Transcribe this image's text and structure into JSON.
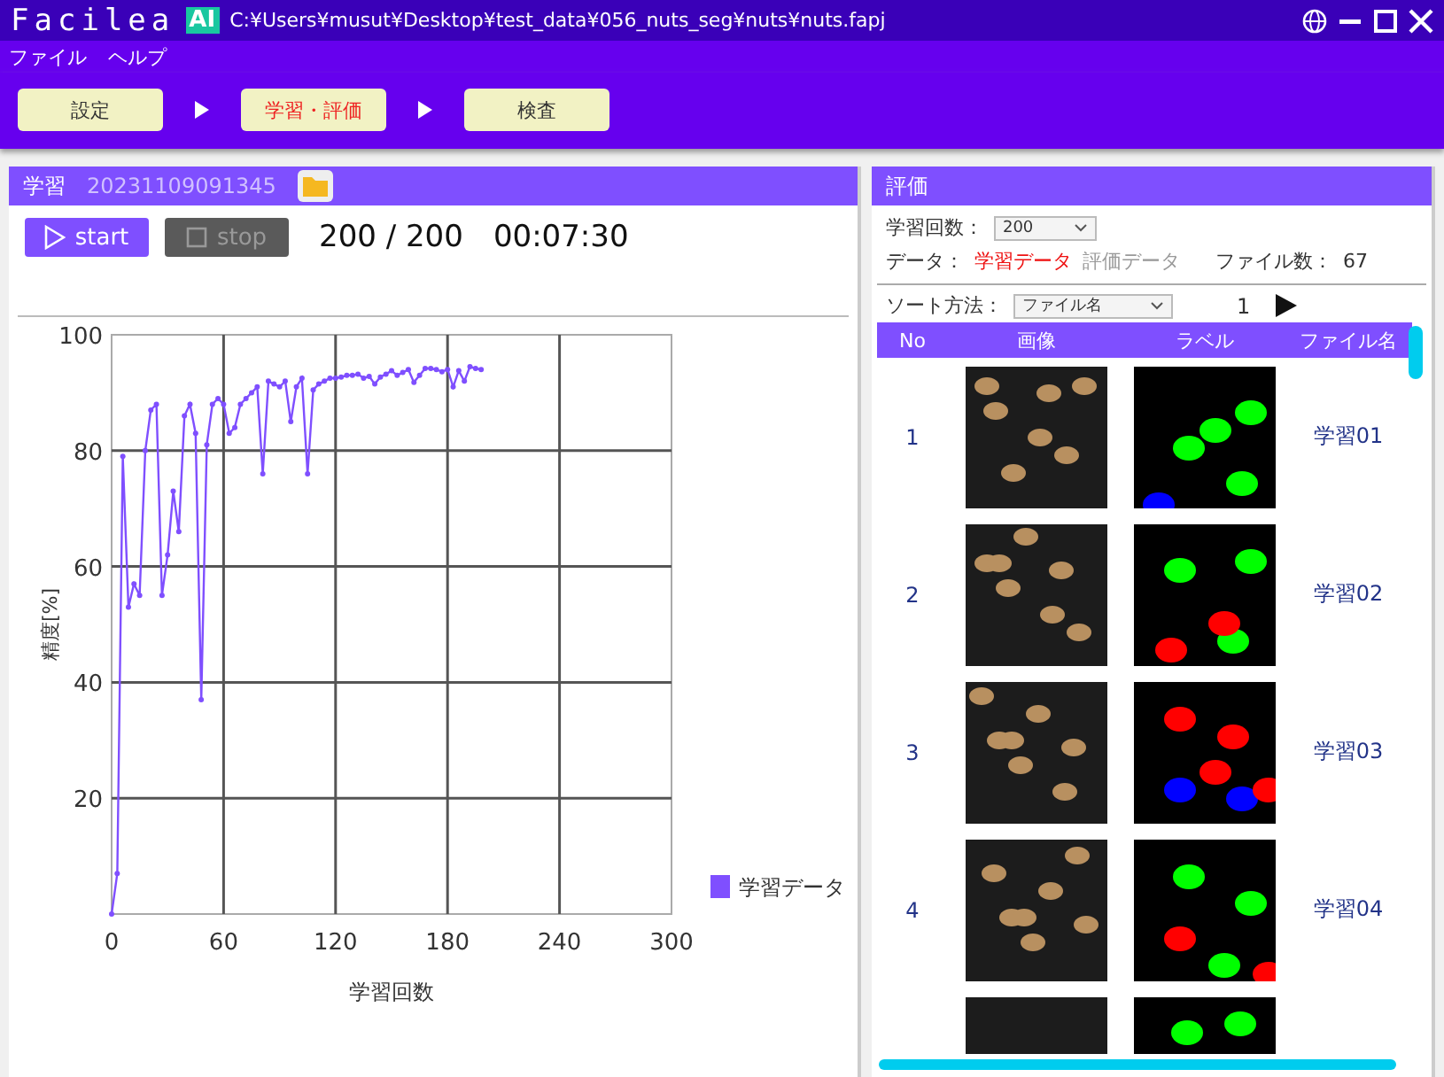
{
  "app": {
    "logo": "Facilea",
    "badge": "AI",
    "path": "C:¥Users¥musut¥Desktop¥test_data¥056_nuts_seg¥nuts¥nuts.fapj"
  },
  "menu": [
    "ファイル",
    "ヘルプ"
  ],
  "steps": [
    {
      "label": "設定",
      "selected": false
    },
    {
      "label": "学習・評価",
      "selected": true
    },
    {
      "label": "検査",
      "selected": false
    }
  ],
  "training": {
    "title": "学習",
    "timestamp": "20231109091345",
    "start": {
      "label": "start",
      "disabled": false
    },
    "stop": {
      "label": "stop",
      "disabled": true
    },
    "progress": "200 / 200",
    "elapsed": "00:07:30",
    "chart_data": {
      "type": "line",
      "grid": true,
      "xlabel": "学習回数",
      "ylabel": "精度[%]",
      "xlim": [
        0,
        300
      ],
      "ylim": [
        0,
        100
      ],
      "xticks": [
        0,
        60,
        120,
        180,
        240,
        300
      ],
      "yticks": [
        20,
        40,
        60,
        80,
        100
      ],
      "x": [
        0,
        3,
        6,
        9,
        12,
        15,
        18,
        21,
        24,
        27,
        30,
        33,
        36,
        39,
        42,
        45,
        48,
        51,
        54,
        57,
        60,
        63,
        66,
        69,
        72,
        75,
        78,
        81,
        84,
        87,
        90,
        93,
        96,
        99,
        102,
        105,
        108,
        111,
        114,
        117,
        120,
        123,
        126,
        129,
        132,
        135,
        138,
        141,
        144,
        147,
        150,
        153,
        156,
        159,
        162,
        165,
        168,
        171,
        174,
        177,
        180,
        183,
        186,
        189,
        192,
        195,
        198
      ],
      "series": [
        {
          "name": "学習データ",
          "color": "#7f4fff",
          "marker": true,
          "values": [
            0,
            7,
            79,
            53,
            57,
            55,
            80,
            87,
            88,
            55,
            62,
            73,
            66,
            86,
            88,
            83,
            37,
            81,
            88,
            89,
            88,
            83,
            84,
            88,
            89,
            90,
            91,
            76,
            92,
            91.5,
            91,
            92,
            85,
            91,
            92.5,
            76,
            90.5,
            91.5,
            92,
            92.5,
            92.5,
            92.7,
            93,
            93,
            93.2,
            92.5,
            92.8,
            91.5,
            92.7,
            93.2,
            93.8,
            93,
            93.5,
            94,
            91.8,
            93,
            94.2,
            94.2,
            94,
            93.6,
            94,
            91,
            93.8,
            92,
            94.5,
            94.2,
            94
          ]
        }
      ]
    }
  },
  "evaluation": {
    "title": "評価",
    "iterations_label": "学習回数：",
    "iterations_value": "200",
    "data_label": "データ：",
    "data_options": [
      {
        "label": "学習データ",
        "selected": true
      },
      {
        "label": "評価データ",
        "selected": false
      }
    ],
    "file_count_label": "ファイル数：",
    "file_count": "67",
    "sort_label": "ソート方法：",
    "sort_value": "ファイル名",
    "page": "1",
    "columns": [
      "No",
      "画像",
      "ラベル",
      "ファイル名"
    ],
    "rows": [
      {
        "no": "1",
        "name": "学習01"
      },
      {
        "no": "2",
        "name": "学習02"
      },
      {
        "no": "3",
        "name": "学習03"
      },
      {
        "no": "4",
        "name": "学習04"
      }
    ]
  }
}
